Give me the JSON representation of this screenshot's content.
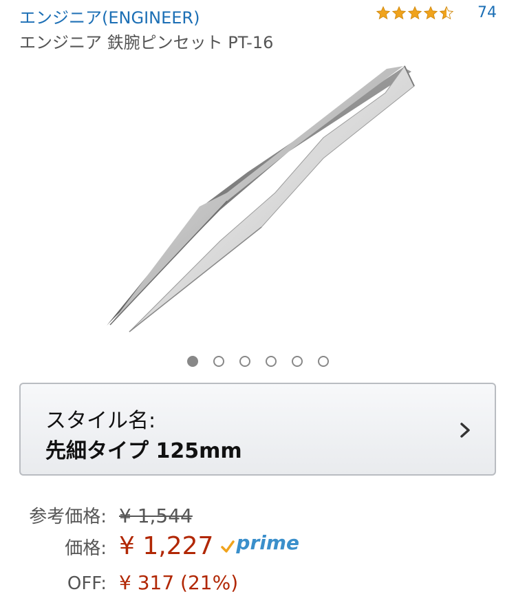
{
  "header": {
    "brand": "エンジニア(ENGINEER)",
    "rating": 4.5,
    "review_count": "74"
  },
  "product": {
    "title": "エンジニア 鉄腕ピンセット PT-16"
  },
  "carousel": {
    "count": 6,
    "active_index": 0
  },
  "style_selector": {
    "label": "スタイル名:",
    "value": "先細タイプ 125mm"
  },
  "pricing": {
    "list_label": "参考価格:",
    "list_price": "¥ 1,544",
    "price_label": "価格:",
    "price": "¥ 1,227",
    "prime_label": "prime",
    "off_label": "OFF:",
    "off_value": "¥ 317 (21%)"
  },
  "colors": {
    "link": "#1c6fb5",
    "price": "#b12704",
    "star": "#f0a31c",
    "prime_check": "#f0a31c",
    "prime_text": "#3a8fcb"
  }
}
